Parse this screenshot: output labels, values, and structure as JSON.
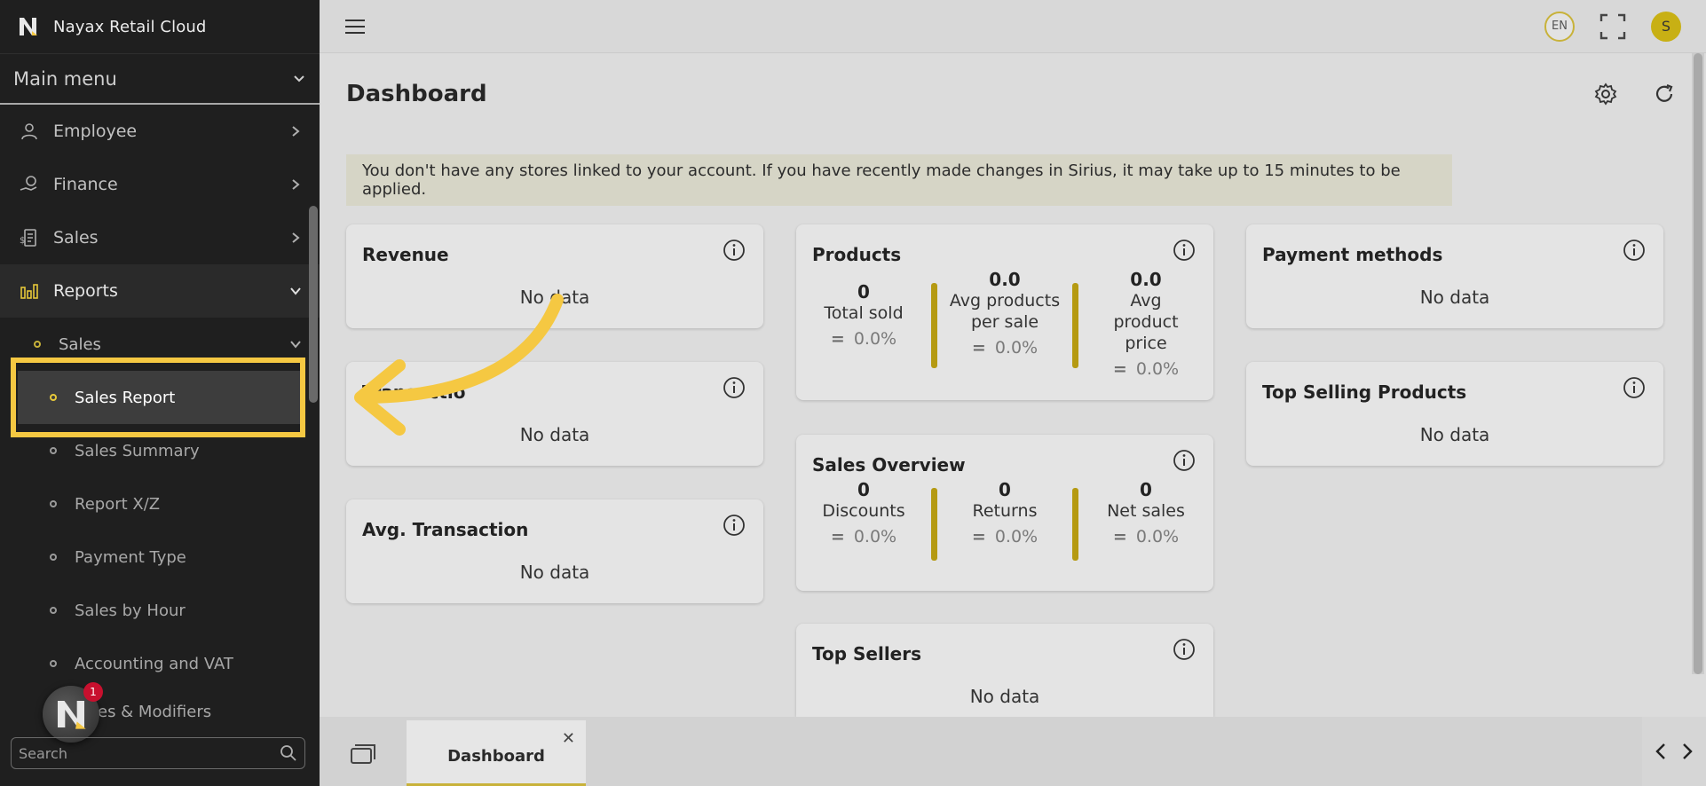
{
  "app": {
    "name": "Nayax Retail Cloud"
  },
  "sidebar": {
    "main_menu_label": "Main menu",
    "items": [
      {
        "label": "Employee",
        "icon": "employee-icon"
      },
      {
        "label": "Finance",
        "icon": "finance-icon"
      },
      {
        "label": "Sales",
        "icon": "sales-icon"
      },
      {
        "label": "Reports",
        "icon": "reports-icon"
      }
    ],
    "reports_sub": {
      "label": "Sales"
    },
    "sales_sub_items": [
      {
        "label": "Sales Report"
      },
      {
        "label": "Sales Summary"
      },
      {
        "label": "Report X/Z"
      },
      {
        "label": "Payment Type"
      },
      {
        "label": "Sales by Hour"
      },
      {
        "label": "Accounting and VAT"
      },
      {
        "label": "es & Modifiers"
      }
    ],
    "search_placeholder": "Search",
    "notification_count": "1"
  },
  "topbar": {
    "language": "EN",
    "avatar_initial": "S"
  },
  "dashboard": {
    "title": "Dashboard",
    "notice": "You don't have any stores linked to your account. If you have recently made changes in Sirius, it may take up to 15 minutes to be applied.",
    "no_data": "No data",
    "revenue": {
      "title": "Revenue"
    },
    "transactions": {
      "title": "Transactio"
    },
    "avg_transaction": {
      "title": "Avg. Transaction"
    },
    "products": {
      "title": "Products",
      "stats": [
        {
          "value": "0",
          "label": "Total sold",
          "pct": "0.0%"
        },
        {
          "value": "0.0",
          "label": "Avg products per sale",
          "pct": "0.0%"
        },
        {
          "value": "0.0",
          "label": "Avg product price",
          "pct": "0.0%"
        }
      ]
    },
    "sales_overview": {
      "title": "Sales Overview",
      "stats": [
        {
          "value": "0",
          "label": "Discounts",
          "pct": "0.0%"
        },
        {
          "value": "0",
          "label": "Returns",
          "pct": "0.0%"
        },
        {
          "value": "0",
          "label": "Net sales",
          "pct": "0.0%"
        }
      ]
    },
    "top_sellers": {
      "title": "Top Sellers"
    },
    "payment_methods": {
      "title": "Payment methods"
    },
    "top_selling_products": {
      "title": "Top Selling Products"
    }
  },
  "bottom_tabs": {
    "dashboard_label": "Dashboard"
  },
  "colors": {
    "accent": "#f5c842",
    "sidebar_bg": "#1f1f1f",
    "separator": "#b59a12"
  }
}
